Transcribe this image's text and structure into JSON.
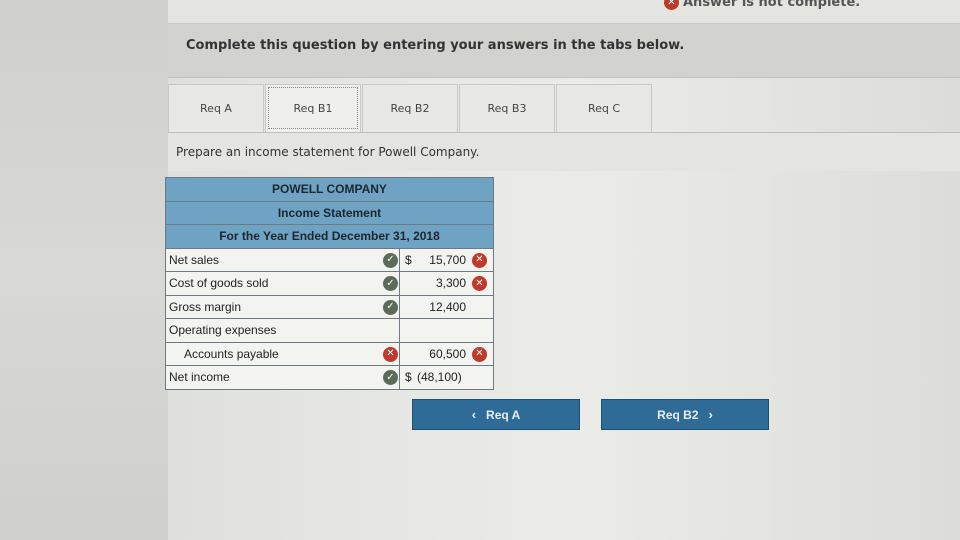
{
  "status": {
    "text": "Answer is not complete."
  },
  "instruction": "Complete this question by entering your answers in the tabs below.",
  "tabs": [
    {
      "label": "Req A",
      "active": false
    },
    {
      "label": "Req B1",
      "active": true
    },
    {
      "label": "Req B2",
      "active": false
    },
    {
      "label": "Req B3",
      "active": false
    },
    {
      "label": "Req C",
      "active": false
    }
  ],
  "prompt": "Prepare an income statement for Powell Company.",
  "statement": {
    "company": "POWELL COMPANY",
    "title": "Income Statement",
    "period": "For the Year Ended December 31, 2018",
    "rows": [
      {
        "label": "Net sales",
        "dollar": "$",
        "amount": "15,700",
        "label_mark": "check",
        "value_mark": "x"
      },
      {
        "label": "Cost of goods sold",
        "dollar": "",
        "amount": "3,300",
        "label_mark": "check",
        "value_mark": "x"
      },
      {
        "label": "Gross margin",
        "dollar": "",
        "amount": "12,400",
        "label_mark": "check",
        "value_mark": ""
      },
      {
        "label": "Operating expenses",
        "dollar": "",
        "amount": "",
        "label_mark": "",
        "value_mark": ""
      },
      {
        "label": "Accounts payable",
        "dollar": "",
        "amount": "60,500",
        "label_mark": "x",
        "value_mark": "x"
      },
      {
        "label": "Net income",
        "dollar": "$",
        "amount": "(48,100)",
        "label_mark": "check",
        "value_mark": ""
      }
    ]
  },
  "buttons": {
    "prev_label": "Req A",
    "next_label": "Req B2"
  },
  "colors": {
    "header_fill": "#6fa3c4",
    "button_fill": "#2e6b96",
    "error_red": "#c0392b",
    "check_gray": "#5a6b5a"
  },
  "icons": {
    "prev": "chevron-left-icon",
    "next": "chevron-right-icon",
    "wrong": "x-circle-icon",
    "right": "check-circle-icon"
  }
}
